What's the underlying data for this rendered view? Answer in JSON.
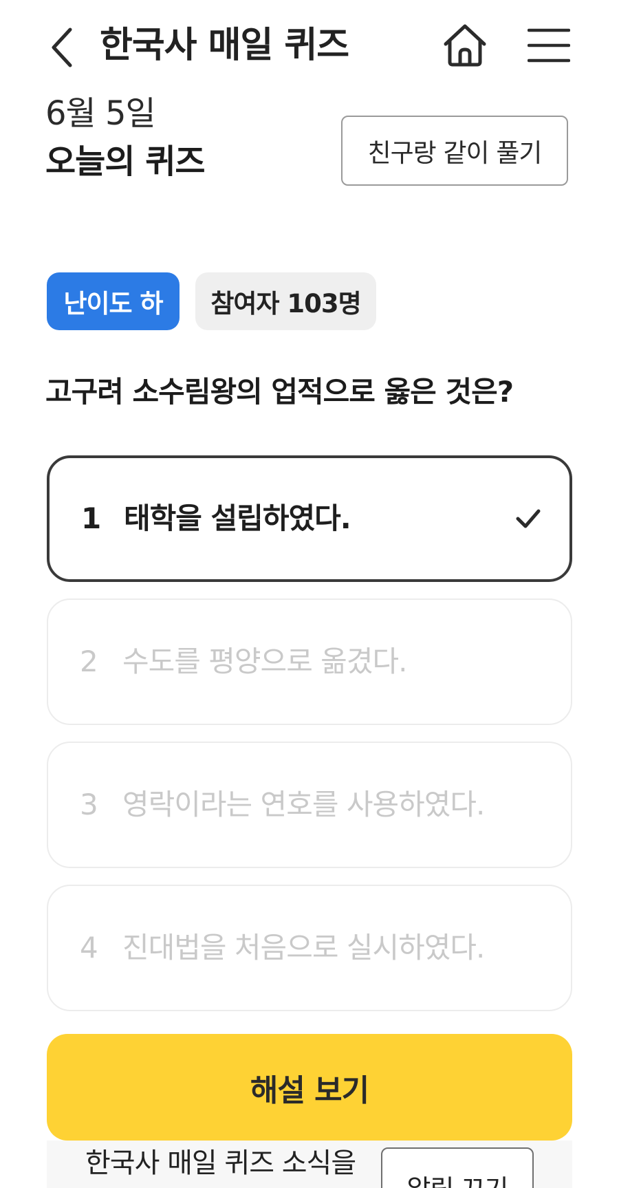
{
  "header": {
    "title": "한국사 매일 퀴즈",
    "back_icon": "chevron-left-icon",
    "home_icon": "home-icon",
    "menu_icon": "hamburger-menu-icon"
  },
  "quiz": {
    "date": "6월 5일",
    "heading": "오늘의 퀴즈",
    "friend_button": "친구랑 같이 풀기",
    "difficulty_badge": "난이도 하",
    "participants_badge": "참여자 103명",
    "question": "고구려 소수림왕의 업적으로 옳은 것은?",
    "options": [
      {
        "number": "1",
        "text": "태학을 설립하였다.",
        "selected": true
      },
      {
        "number": "2",
        "text": "수도를 평양으로 옮겼다.",
        "selected": false
      },
      {
        "number": "3",
        "text": "영락이라는 연호를 사용하였다.",
        "selected": false
      },
      {
        "number": "4",
        "text": "진대법을 처음으로 실시하였다.",
        "selected": false
      }
    ],
    "explain_button": "해설 보기"
  },
  "notification": {
    "text": "한국사 매일 퀴즈 소식을",
    "button": "알림 끄기"
  },
  "colors": {
    "accent_blue": "#2c7be5",
    "cta_yellow": "#fed234",
    "badge_gray": "#efefef"
  }
}
